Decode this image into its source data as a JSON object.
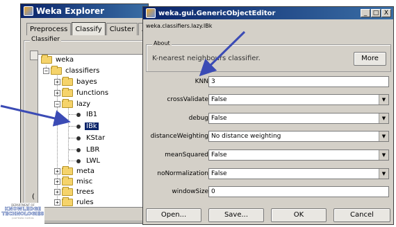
{
  "explorer": {
    "title": "Weka Explorer",
    "tabs": [
      "Preprocess",
      "Classify",
      "Cluster",
      "A"
    ],
    "classifier_group_label": "Classifier",
    "tree": {
      "root": "weka",
      "classifiers": "classifiers",
      "bayes": "bayes",
      "functions": "functions",
      "lazy": "lazy",
      "ib1": "IB1",
      "ibk": "IBk",
      "kstar": "KStar",
      "lbr": "LBR",
      "lwl": "LWL",
      "meta": "meta",
      "misc": "misc",
      "trees": "trees",
      "rules": "rules"
    },
    "left_edge_char": "(",
    "logo": {
      "line1": "DEPARTMENT OF",
      "line2": "KNOWLEDGE",
      "line3": "TECHNOLOGIES",
      "line4": "Jozef Stefan Institute"
    }
  },
  "editor": {
    "title": "weka.gui.GenericObjectEditor",
    "window_buttons": [
      "_",
      "□",
      "X"
    ],
    "class_name": "weka.classifiers.lazy.IBk",
    "about_label": "About",
    "about_text": "K-nearest neighbours classifier.",
    "more_button": "More",
    "params": {
      "knn": {
        "label": "KNN",
        "value": "3"
      },
      "crossValidate": {
        "label": "crossValidate",
        "value": "False"
      },
      "debug": {
        "label": "debug",
        "value": "False"
      },
      "distanceWeighting": {
        "label": "distanceWeighting",
        "value": "No distance weighting"
      },
      "meanSquared": {
        "label": "meanSquared",
        "value": "False"
      },
      "noNormalization": {
        "label": "noNormalization",
        "value": "False"
      },
      "windowSize": {
        "label": "windowSize",
        "value": "0"
      }
    },
    "buttons": {
      "open": "Open...",
      "save": "Save...",
      "ok": "OK",
      "cancel": "Cancel"
    }
  },
  "colors": {
    "titlebar_start": "#0a246a",
    "titlebar_end": "#3a6ea5",
    "window_face": "#d4d0c8",
    "arrow": "#3b4bb5"
  },
  "icons": [
    "folder-icon",
    "leaf-node-icon",
    "expand-plus-icon",
    "collapse-minus-icon",
    "dropdown-arrow-icon",
    "annotation-arrow-icon"
  ]
}
